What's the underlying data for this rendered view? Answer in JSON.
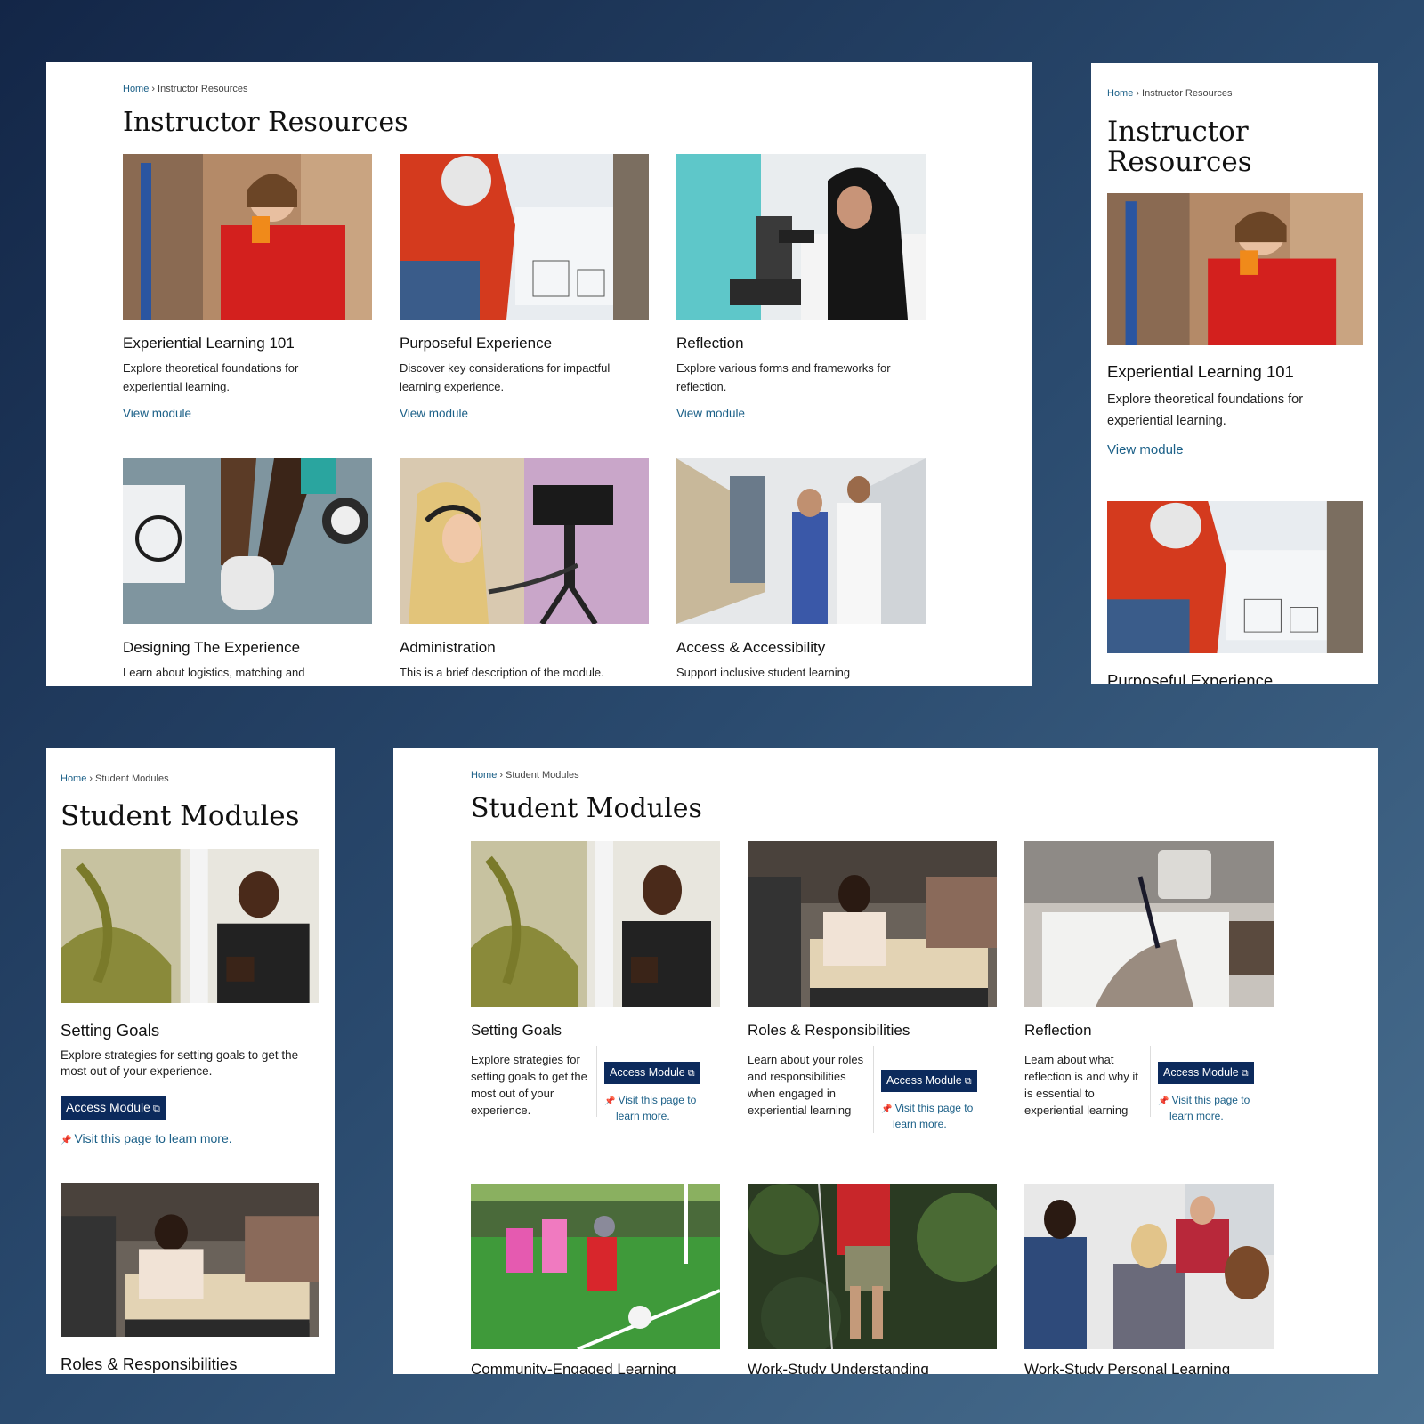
{
  "breadcrumb": {
    "home": "Home",
    "sep": "›"
  },
  "instructor": {
    "current": "Instructor Resources",
    "title": "Instructor Resources",
    "link_label": "View module",
    "cards": [
      {
        "title": "Experiential Learning 101",
        "desc": "Explore theoretical foundations for experiential learning."
      },
      {
        "title": "Purposeful Experience",
        "desc": "Discover key considerations for impactful learning experience."
      },
      {
        "title": "Reflection",
        "desc": "Explore various forms and frameworks for reflection."
      },
      {
        "title": "Designing The Experience",
        "desc": "Learn about logistics, matching and"
      },
      {
        "title": "Administration",
        "desc": "This is a brief description of the module."
      },
      {
        "title": "Access & Accessibility",
        "desc": "Support inclusive student learning"
      }
    ],
    "mobile_title_line1": "Instructor",
    "mobile_title_line2": "Resources"
  },
  "student": {
    "current": "Student Modules",
    "title": "Student Modules",
    "access_label": "Access Module",
    "visit_label": "Visit this page to learn more.",
    "visit_line1": "Visit this page to",
    "visit_line2": "learn more.",
    "cards": [
      {
        "title": "Setting Goals",
        "desc": "Explore strategies for setting goals to get the most out of your experience."
      },
      {
        "title": "Roles & Responsibilities",
        "desc": "Learn about your roles and responsibilities when engaged in experiential learning"
      },
      {
        "title": "Reflection",
        "desc": "Learn about what reflection is and why it is essential to experiential learning"
      },
      {
        "title": "Community-Engaged Learning",
        "desc": ""
      },
      {
        "title": "Work-Study Understanding",
        "desc": ""
      },
      {
        "title": "Work-Study Personal Learning",
        "desc": ""
      }
    ]
  },
  "icons": {
    "external": "external-link-icon",
    "pin": "pushpin-icon"
  },
  "colors": {
    "link": "#1a5f87",
    "button": "#0c2a5c",
    "bg_top": "#132647",
    "bg_bottom": "#4a7090"
  }
}
